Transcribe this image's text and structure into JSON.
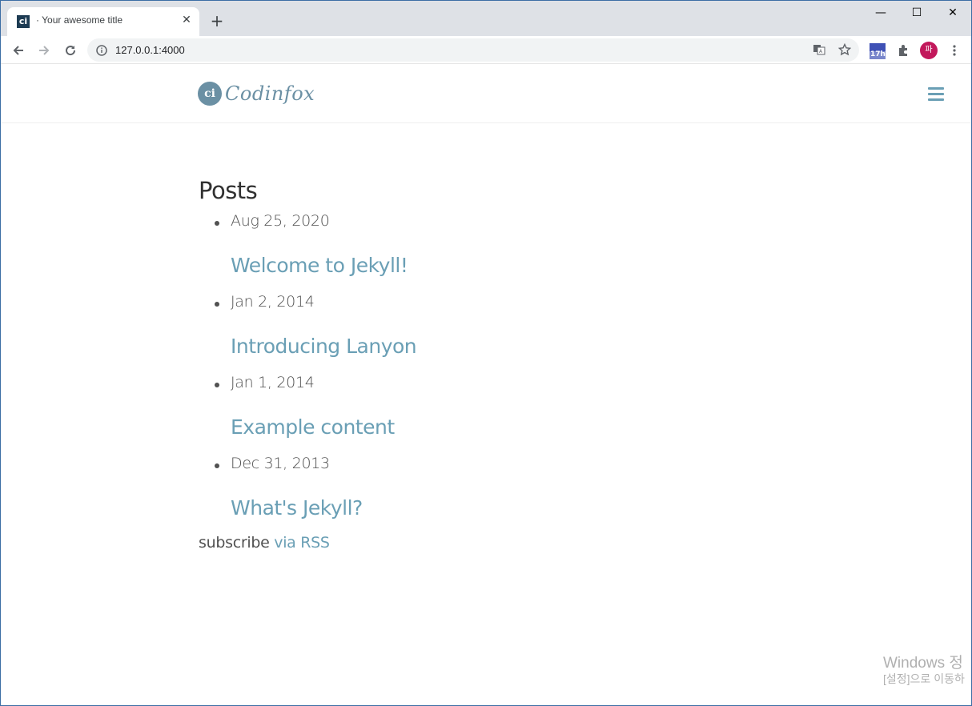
{
  "browser": {
    "tab_title": "· Your awesome title",
    "favicon_text": "ci",
    "new_tab_symbol": "+",
    "url": "127.0.0.1:4000",
    "extension_badge": "17h",
    "profile_initial": "파"
  },
  "site": {
    "logo_mark": "ci",
    "logo_text": "Codinfox"
  },
  "main": {
    "heading": "Posts",
    "posts": [
      {
        "date": "Aug 25, 2020",
        "title": "Welcome to Jekyll!"
      },
      {
        "date": "Jan 2, 2014",
        "title": "Introducing Lanyon"
      },
      {
        "date": "Jan 1, 2014",
        "title": "Example content"
      },
      {
        "date": "Dec 31, 2013",
        "title": "What's Jekyll?"
      }
    ],
    "subscribe_prefix": "subscribe",
    "subscribe_link": "via RSS"
  },
  "os": {
    "watermark_line1": "Windows 정",
    "watermark_line2": "[설정]으로 이동하"
  },
  "colors": {
    "link": "#6a9fb5",
    "text": "#515151",
    "heading": "#313131"
  }
}
